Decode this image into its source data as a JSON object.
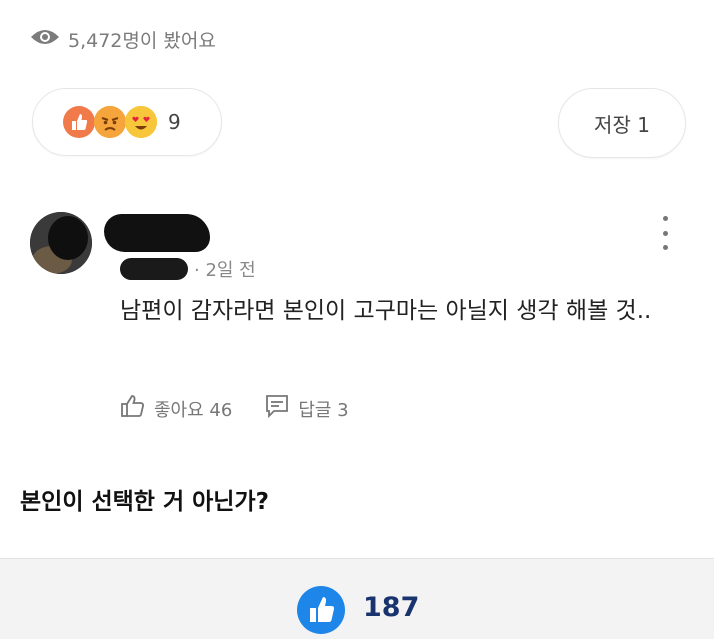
{
  "views": {
    "icon": "eye-icon",
    "text": "5,472명이 봤어요"
  },
  "reactions": {
    "icons": [
      "thumbs-up-icon",
      "angry-face-icon",
      "heart-eyes-face-icon"
    ],
    "count": "9"
  },
  "save": {
    "label": "저장 1"
  },
  "comment": {
    "time": "· 2일 전",
    "text": "남편이 감자라면 본인이 고구마는 아닐지 생각 해볼 것..",
    "like_label": "좋아요 46",
    "reply_label": "답글 3"
  },
  "post_text": "본인이 선택한 거 아닌가?",
  "footer": {
    "like_count": "187",
    "accent": "#1d86e8"
  }
}
